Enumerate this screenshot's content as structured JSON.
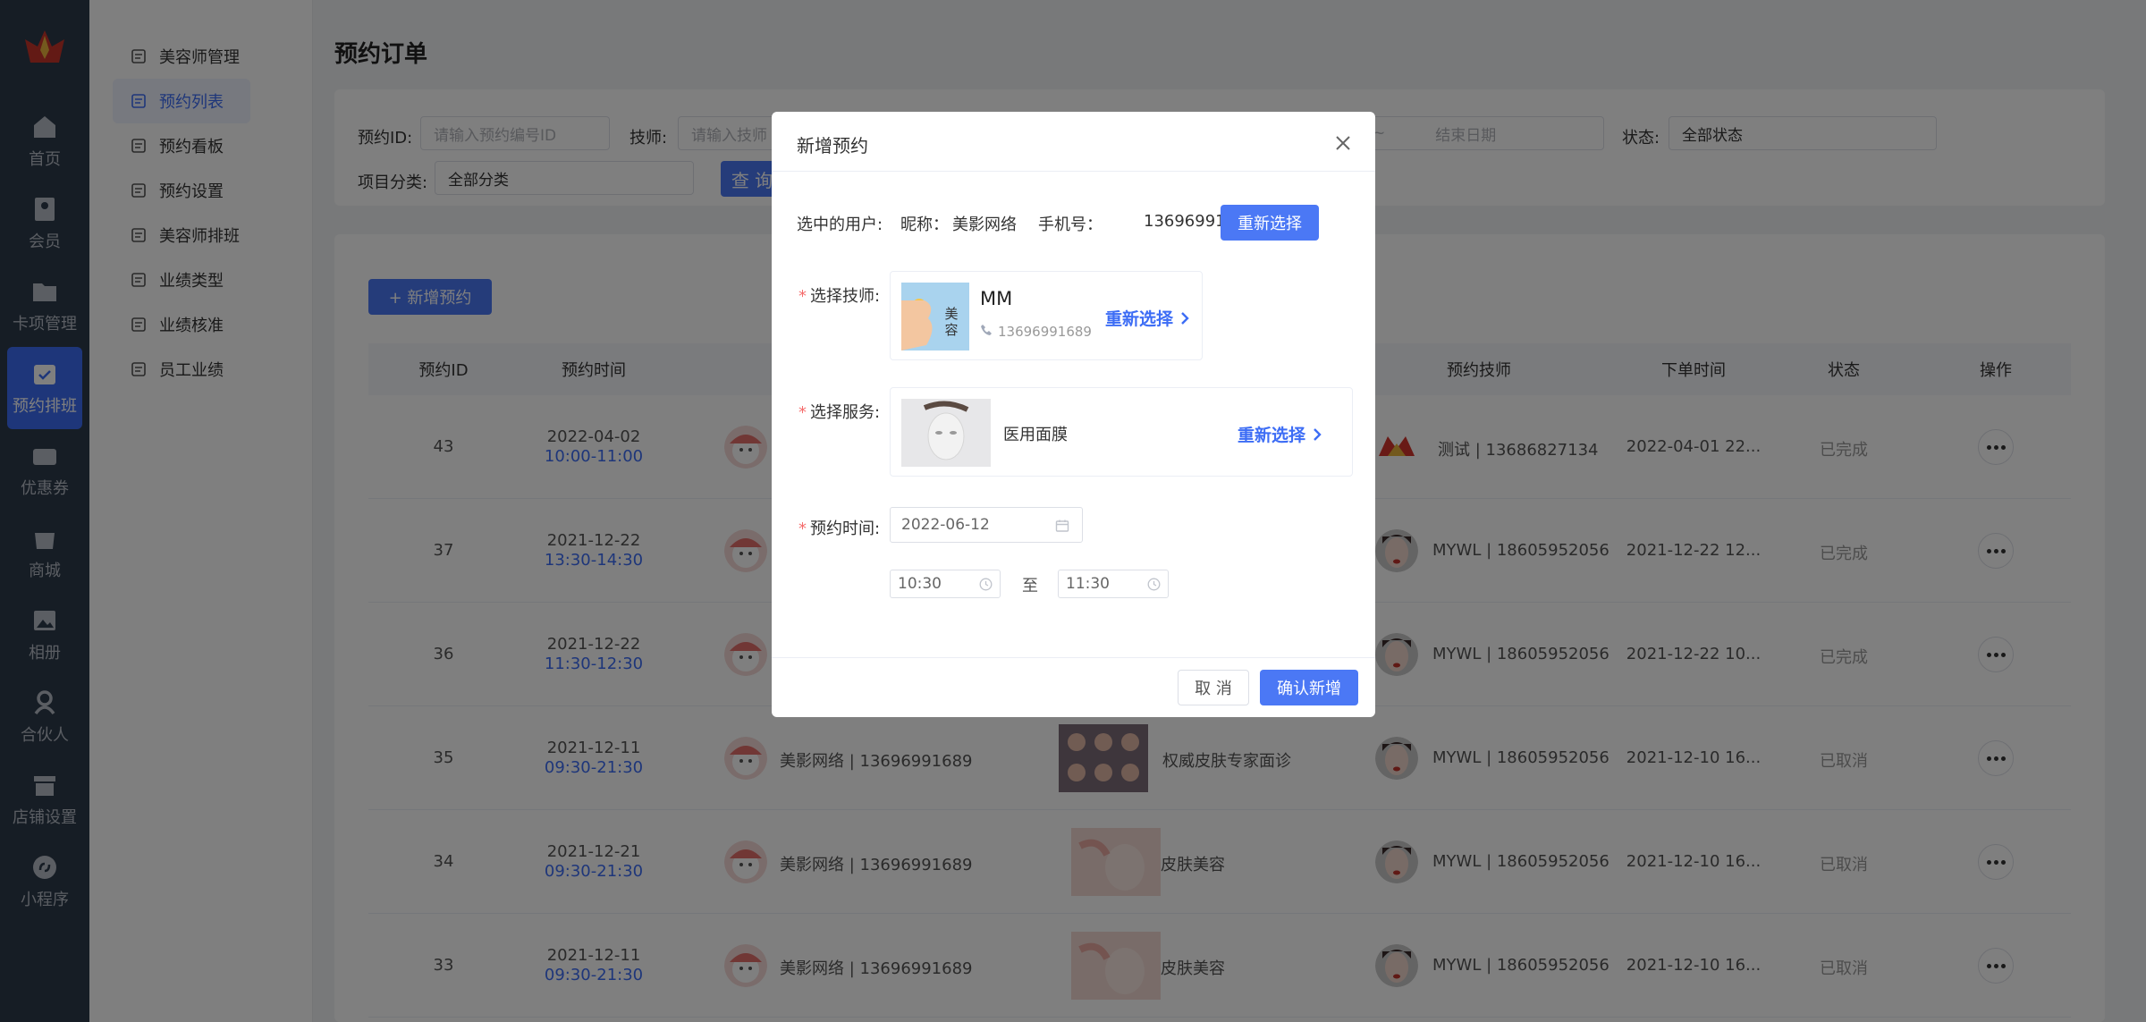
{
  "rail": {
    "items": [
      {
        "label": "首页",
        "icon": "home-icon"
      },
      {
        "label": "会员",
        "icon": "member-card-icon"
      },
      {
        "label": "卡项管理",
        "icon": "card-folder-icon"
      },
      {
        "label": "预约排班",
        "icon": "calendar-check-icon"
      },
      {
        "label": "优惠券",
        "icon": "wallet-icon"
      },
      {
        "label": "商城",
        "icon": "shopping-bag-icon"
      },
      {
        "label": "相册",
        "icon": "photo-album-icon"
      },
      {
        "label": "合伙人",
        "icon": "partner-icon"
      },
      {
        "label": "店铺设置",
        "icon": "store-settings-icon"
      },
      {
        "label": "小程序",
        "icon": "mini-program-icon"
      }
    ]
  },
  "submenu": {
    "items": [
      {
        "label": "美容师管理",
        "icon": "user-icon"
      },
      {
        "label": "预约列表",
        "icon": "list-icon"
      },
      {
        "label": "预约看板",
        "icon": "board-icon"
      },
      {
        "label": "预约设置",
        "icon": "settings-icon"
      },
      {
        "label": "美容师排班",
        "icon": "schedule-icon"
      },
      {
        "label": "业绩类型",
        "icon": "type-icon"
      },
      {
        "label": "业绩核准",
        "icon": "approve-icon"
      },
      {
        "label": "员工业绩",
        "icon": "chart-icon"
      }
    ]
  },
  "page": {
    "title": "预约订单"
  },
  "filters": {
    "id_label": "预约ID:",
    "id_placeholder": "请输入预约编号ID",
    "tech_label": "技师:",
    "tech_placeholder": "请输入技师",
    "date_sep": "~",
    "end_date_placeholder": "结束日期",
    "status_label": "状态:",
    "status_value": "全部状态",
    "category_label": "项目分类:",
    "category_value": "全部分类",
    "query_label": "查 询"
  },
  "toolbar": {
    "add_label": "+ 新增预约"
  },
  "table": {
    "headers": {
      "id": "预约ID",
      "time": "预约时间",
      "tech": "预约技师",
      "order_time": "下单时间",
      "status": "状态",
      "op": "操作"
    },
    "rows": [
      {
        "id": "43",
        "date": "2022-04-02",
        "slot": "10:00-11:00",
        "user": "",
        "service": "",
        "tech": "测试 | 13686827134",
        "order_time": "2022-04-01 22...",
        "status": "已完成"
      },
      {
        "id": "37",
        "date": "2021-12-22",
        "slot": "13:30-14:30",
        "user": "",
        "service": "",
        "tech": "MYWL | 18605952056",
        "order_time": "2021-12-22 12...",
        "status": "已完成"
      },
      {
        "id": "36",
        "date": "2021-12-22",
        "slot": "11:30-12:30",
        "user": "",
        "service": "",
        "tech": "MYWL | 18605952056",
        "order_time": "2021-12-22 10...",
        "status": "已完成"
      },
      {
        "id": "35",
        "date": "2021-12-11",
        "slot": "09:30-21:30",
        "user": "美影网络 | 13696991689",
        "service": "权威皮肤专家面诊",
        "tech": "MYWL | 18605952056",
        "order_time": "2021-12-10 16...",
        "status": "已取消"
      },
      {
        "id": "34",
        "date": "2021-12-21",
        "slot": "09:30-21:30",
        "user": "美影网络 | 13696991689",
        "service": "皮肤美容",
        "tech": "MYWL | 18605952056",
        "order_time": "2021-12-10 16...",
        "status": "已取消"
      },
      {
        "id": "33",
        "date": "2021-12-11",
        "slot": "09:30-21:30",
        "user": "美影网络 | 13696991689",
        "service": "皮肤美容",
        "tech": "MYWL | 18605952056",
        "order_time": "2021-12-10 16...",
        "status": "已取消"
      }
    ]
  },
  "modal": {
    "title": "新增预约",
    "user_label": "选中的用户:",
    "nick_label": "昵称：",
    "nick_value": "美影网络",
    "phone_label": "手机号：",
    "phone_value": "13696991689",
    "reselect_label": "重新选择",
    "tech_label": "选择技师:",
    "tech_name": "MM",
    "tech_phone": "13696991689",
    "tech_reselect": "重新选择",
    "service_label": "选择服务:",
    "service_name": "医用面膜",
    "service_reselect": "重新选择",
    "time_label": "预约时间:",
    "date_value": "2022-06-12",
    "start_time": "10:30",
    "to_label": "至",
    "end_time": "11:30",
    "cancel_label": "取 消",
    "confirm_label": "确认新增"
  },
  "colors": {
    "primary": "#4b78f5",
    "rail": "#2d3a4b",
    "link": "#3d6df5"
  }
}
